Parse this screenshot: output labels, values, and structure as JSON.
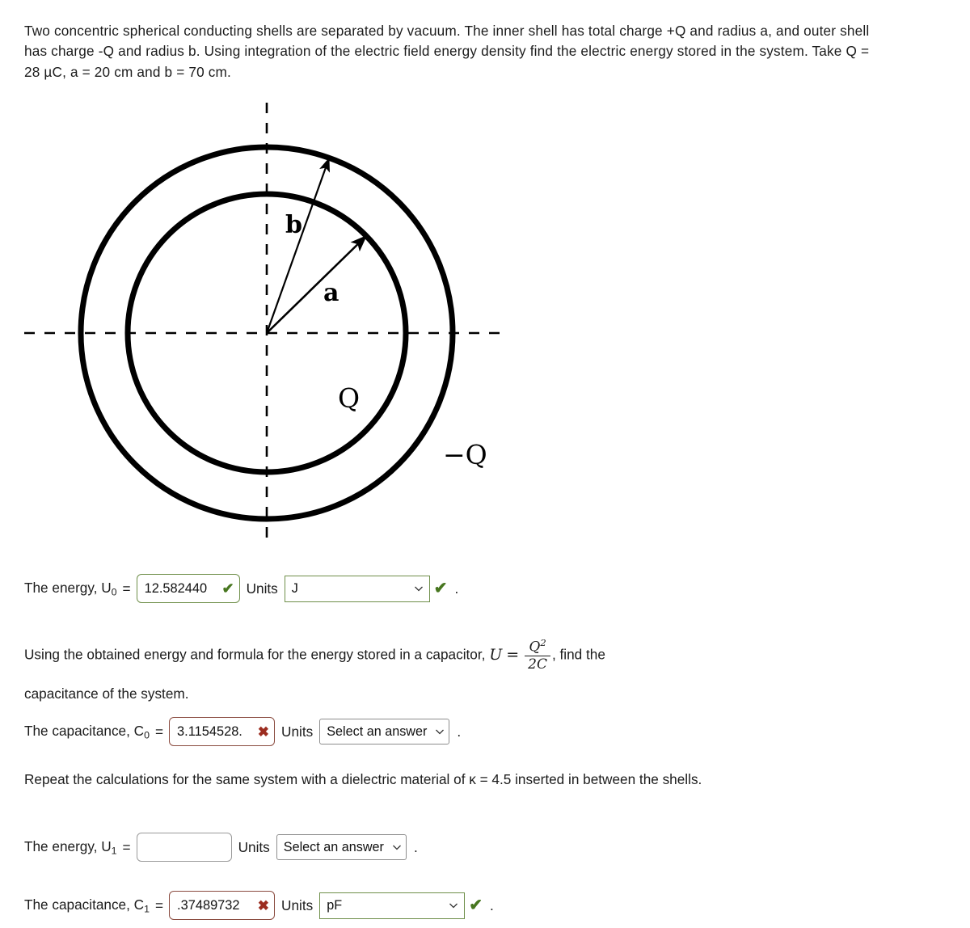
{
  "problem": {
    "statement": "Two concentric spherical conducting shells are separated by vacuum. The inner shell has total charge +Q and radius a, and outer shell has charge -Q and radius b. Using integration of the electric field energy density find the electric energy stored in the system. Take Q = 28 µC, a = 20 cm and b = 70 cm."
  },
  "figure": {
    "label_b": "b",
    "label_a": "a",
    "label_q": "Q",
    "label_minus_q": "−Q",
    "stroke_color": "#000000",
    "axis_style": "dashed"
  },
  "rows": {
    "u0": {
      "label_text": "The energy, U",
      "label_sub": "0",
      "equals": "=",
      "value": "12.582440",
      "mark": "✔",
      "mark_state": "correct",
      "units_word": "Units",
      "unit_value": "J",
      "unit_state": "correct",
      "trailing_check": "✔",
      "period": "."
    },
    "c0": {
      "label_text": "The capacitance, C",
      "label_sub": "0",
      "equals": "=",
      "value": "3.1154528.",
      "mark": "✖",
      "mark_state": "incorrect",
      "units_word": "Units",
      "unit_value": "Select an answer",
      "unit_state": "unselected",
      "period": "."
    },
    "u1": {
      "label_text": "The energy, U",
      "label_sub": "1",
      "equals": "=",
      "value": "",
      "mark": "",
      "mark_state": "empty",
      "units_word": "Units",
      "unit_value": "Select an answer",
      "unit_state": "unselected",
      "period": "."
    },
    "c1": {
      "label_text": "The capacitance, C",
      "label_sub": "1",
      "equals": "=",
      "value": ".37489732",
      "mark": "✖",
      "mark_state": "incorrect",
      "units_word": "Units",
      "unit_value": "pF",
      "unit_state": "correct",
      "trailing_check": "✔",
      "period": "."
    }
  },
  "formula_para": {
    "lead": "Using the obtained energy and formula for the energy stored in a capacitor,",
    "math_u": "U",
    "math_eq": "=",
    "math_num": "Q",
    "math_num_exp": "2",
    "math_den": "2C",
    "math_comma": ",",
    "trail": "find the",
    "line2": "capacitance of the system."
  },
  "dielectric_para": {
    "text": "Repeat the calculations for the same system with a dielectric material of κ = 4.5 inserted in between the shells."
  },
  "colors": {
    "correct_border": "#6f8f4a",
    "incorrect_border": "#8a4b3f",
    "neutral_border": "#9a9a9a",
    "check_green": "#47761f",
    "cross_red": "#9c2d20",
    "text": "#1c1c1c"
  }
}
